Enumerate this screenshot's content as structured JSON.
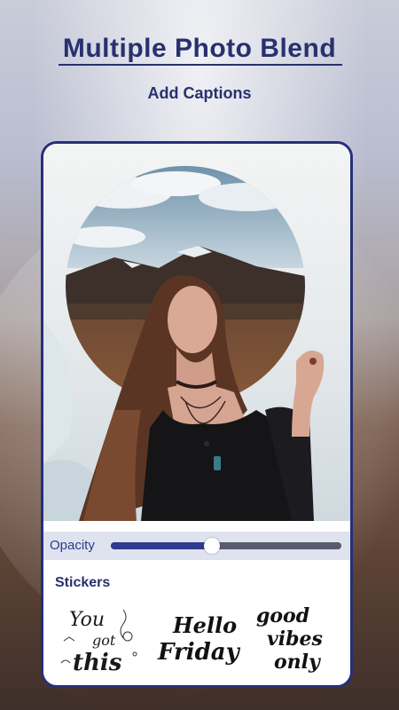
{
  "header": {
    "title": "Multiple Photo Blend",
    "subtitle": "Add Captions"
  },
  "editor": {
    "opacity_label": "Opacity",
    "opacity_value": 0.44,
    "stickers_label": "Stickers",
    "stickers": [
      {
        "text": "You got this",
        "lines": [
          "You",
          "got",
          "this"
        ]
      },
      {
        "text": "Hello Friday",
        "lines": [
          "Hello",
          "Friday"
        ]
      },
      {
        "text": "good vibes only",
        "lines": [
          "good",
          "vibes",
          "only"
        ]
      }
    ]
  },
  "colors": {
    "brand_navy": "#28306e",
    "slider_fill": "#2f3b8c",
    "slider_track": "#595c6d",
    "card_border": "#262f7a"
  }
}
